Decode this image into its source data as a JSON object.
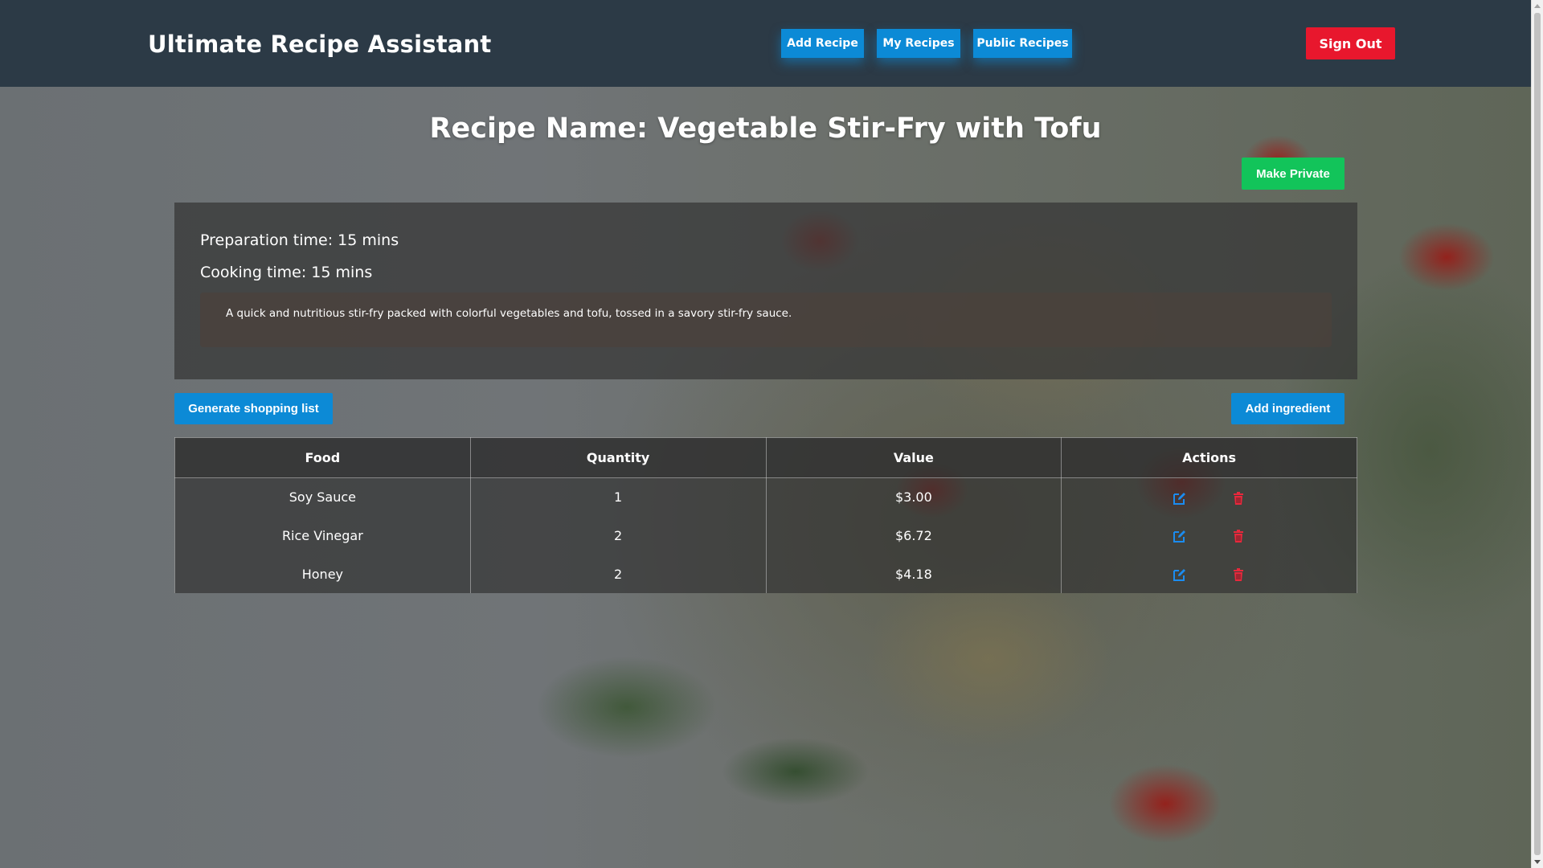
{
  "header": {
    "brand": "Ultimate Recipe Assistant",
    "nav": {
      "add_recipe": "Add Recipe",
      "my_recipes": "My Recipes",
      "public_recipes": "Public Recipes"
    },
    "sign_out": "Sign Out"
  },
  "recipe": {
    "title": "Recipe Name: Vegetable Stir-Fry with Tofu",
    "make_private": "Make Private",
    "preparation": "Preparation time: 15 mins",
    "cooking": "Cooking time: 15 mins",
    "description": "A quick and nutritious stir-fry packed with colorful vegetables and tofu, tossed in a savory stir-fry sauce."
  },
  "actions": {
    "generate_list": "Generate shopping list",
    "add_ingredient": "Add ingredient"
  },
  "table": {
    "columns": [
      "Food",
      "Quantity",
      "Value",
      "Actions"
    ],
    "rows": [
      {
        "food": "Soy Sauce",
        "quantity": "1",
        "value": "$3.00"
      },
      {
        "food": "Rice Vinegar",
        "quantity": "2",
        "value": "$6.72"
      },
      {
        "food": "Honey",
        "quantity": "2",
        "value": "$4.18"
      }
    ]
  },
  "icons": {
    "edit": "edit-icon",
    "delete": "trash-icon"
  },
  "colors": {
    "header_bg": "#2c3a46",
    "primary_blue": "#0c8ad6",
    "danger_red": "#e8172d",
    "success_green": "#12c45a",
    "edit_icon": "#1b8cf0",
    "trash_icon": "#e8283c"
  }
}
